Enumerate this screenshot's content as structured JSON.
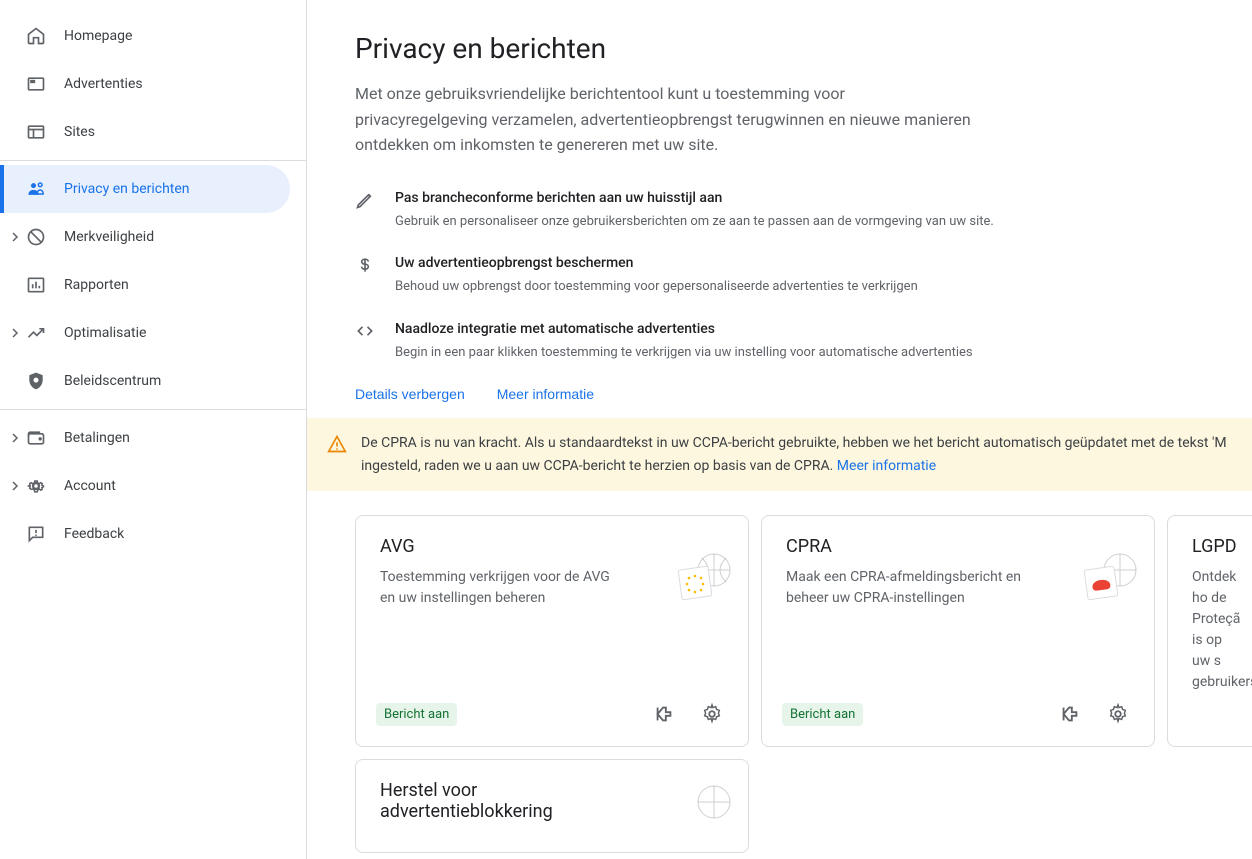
{
  "sidebar": {
    "items": [
      {
        "label": "Homepage",
        "icon": "home",
        "expandable": false
      },
      {
        "label": "Advertenties",
        "icon": "ads",
        "expandable": false
      },
      {
        "label": "Sites",
        "icon": "sites",
        "expandable": false
      }
    ],
    "active": {
      "label": "Privacy en berichten",
      "icon": "privacy"
    },
    "items2": [
      {
        "label": "Merkveiligheid",
        "icon": "block",
        "expandable": true
      },
      {
        "label": "Rapporten",
        "icon": "reports",
        "expandable": false
      },
      {
        "label": "Optimalisatie",
        "icon": "trending",
        "expandable": true
      },
      {
        "label": "Beleidscentrum",
        "icon": "policy",
        "expandable": false
      }
    ],
    "items3": [
      {
        "label": "Betalingen",
        "icon": "payments",
        "expandable": true
      },
      {
        "label": "Account",
        "icon": "settings",
        "expandable": true
      },
      {
        "label": "Feedback",
        "icon": "feedback",
        "expandable": false
      }
    ]
  },
  "page": {
    "title": "Privacy en berichten",
    "desc": "Met onze gebruiksvriendelijke berichtentool kunt u toestemming voor privacyregelgeving verzamelen, advertentieopbrengst terugwinnen en nieuwe manieren ontdekken om inkomsten te genereren met uw site."
  },
  "features": [
    {
      "title": "Pas brancheconforme berichten aan uw huisstijl aan",
      "desc": "Gebruik en personaliseer onze gebruikersberichten om ze aan te passen aan de vormgeving van uw site."
    },
    {
      "title": "Uw advertentieopbrengst beschermen",
      "desc": "Behoud uw opbrengst door toestemming voor gepersonaliseerde advertenties te verkrijgen"
    },
    {
      "title": "Naadloze integratie met automatische advertenties",
      "desc": "Begin in een paar klikken toestemming te verkrijgen via uw instelling voor automatische advertenties"
    }
  ],
  "actions": {
    "hide": "Details verbergen",
    "more": "Meer informatie"
  },
  "alert": {
    "text": "De CPRA is nu van kracht. Als u standaardtekst in uw CCPA-bericht gebruikte, hebben we het bericht automatisch geüpdatet met de tekst 'M         ingesteld, raden we u aan uw CCPA-bericht te herzien op basis van de CPRA. ",
    "link": "Meer informatie"
  },
  "cards": [
    {
      "title": "AVG",
      "desc": "Toestemming verkrijgen voor de AVG en uw instellingen beheren",
      "badge": "Bericht aan",
      "illust": "eu"
    },
    {
      "title": "CPRA",
      "desc": "Maak een CPRA-afmeldingsbericht en beheer uw CPRA-instellingen",
      "badge": "Bericht aan",
      "illust": "bear"
    },
    {
      "title": "LGPD",
      "desc": "Ontdek ho de Proteçã is op uw s gebruikers",
      "badge": "",
      "illust": ""
    }
  ],
  "card_partial": {
    "title": "Herstel voor advertentieblokkering"
  }
}
